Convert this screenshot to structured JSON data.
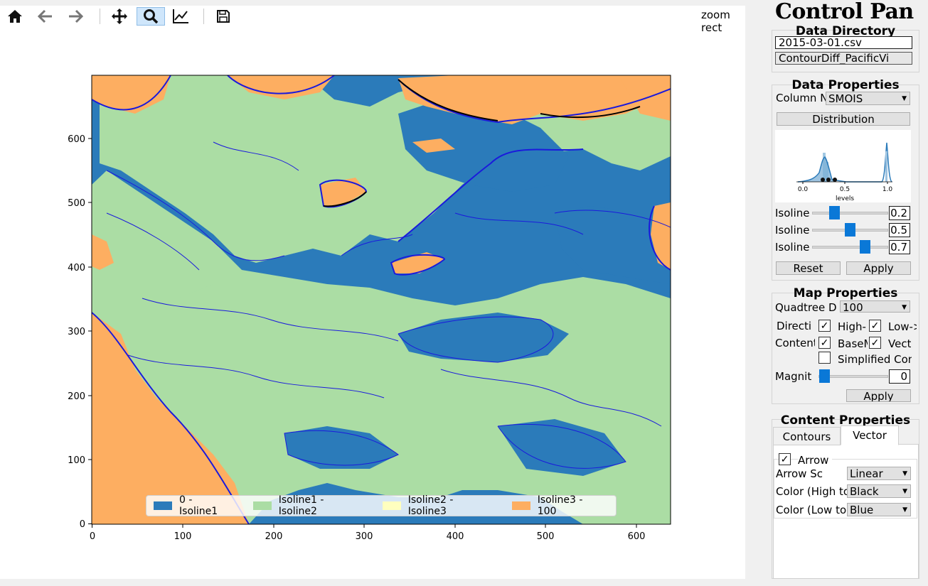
{
  "toolbar": {
    "buttons": [
      {
        "name": "home",
        "icon": "home-icon"
      },
      {
        "name": "back",
        "icon": "arrow-left-icon"
      },
      {
        "name": "forward",
        "icon": "arrow-right-icon"
      },
      {
        "name": "pan",
        "icon": "move-icon"
      },
      {
        "name": "zoom",
        "icon": "magnifier-icon",
        "active": true
      },
      {
        "name": "subplots",
        "icon": "chart-line-icon"
      },
      {
        "name": "save",
        "icon": "floppy-disk-icon"
      }
    ],
    "status": "zoom rect"
  },
  "plot": {
    "xticks": [
      "0",
      "100",
      "200",
      "300",
      "400",
      "500",
      "600"
    ],
    "yticks": [
      "0",
      "100",
      "200",
      "300",
      "400",
      "500",
      "600"
    ],
    "legend": [
      {
        "label": "0 - Isoline1",
        "color": "#2b7bba"
      },
      {
        "label": "Isoline1 - Isoline2",
        "color": "#abdda4"
      },
      {
        "label": "Isoline2 - Isoline3",
        "color": "#ffffbf"
      },
      {
        "label": "Isoline3 - 100",
        "color": "#fdae61"
      }
    ],
    "colors": {
      "water": "#2b7bba",
      "land": "#abdda4",
      "high": "#fdae61",
      "contour": "#1a1adc"
    }
  },
  "panel": {
    "title": "Control Pan",
    "data_directory": {
      "title": "Data Directory",
      "file": "2015-03-01.csv",
      "output": "ContourDiff_PacificVi"
    },
    "data_properties": {
      "title": "Data Properties",
      "column_label": "Column N",
      "column_value": "SMOIS",
      "distribution_button": "Distribution",
      "mini_chart_xlabel": "levels",
      "mini_chart_xticks": [
        "0.0",
        "0.5",
        "1.0"
      ],
      "isolines": [
        {
          "label": "Isoline",
          "value": "0.2",
          "level": 0.2
        },
        {
          "label": "Isoline",
          "value": "0.5",
          "level": 0.5
        },
        {
          "label": "Isoline",
          "value": "0.7",
          "level": 0.7
        }
      ],
      "reset_button": "Reset",
      "apply_button": "Apply"
    },
    "map_properties": {
      "title": "Map Properties",
      "quadtree_label": "Quadtree D",
      "quadtree_value": "100",
      "direction_label": "Directi",
      "high_label": "High-",
      "low_label": "Low->",
      "content_label": "Content",
      "basemap_label": "BaseM",
      "vector_label": "Vecto",
      "simplified_label": "Simplified Con",
      "magnitude_label": "Magnitu",
      "magnitude_value": "0",
      "apply_button": "Apply"
    },
    "content_properties": {
      "title": "Content Properties",
      "tabs": [
        "Contours",
        "Vector"
      ],
      "active_tab": "Vector",
      "arrow_label": "Arrow",
      "arrow_scale_label": "Arrow Sc",
      "arrow_scale_value": "Linear",
      "color_high_label": "Color (High to",
      "color_high_value": "Black",
      "color_low_label": "Color (Low to",
      "color_low_value": "Blue"
    }
  }
}
